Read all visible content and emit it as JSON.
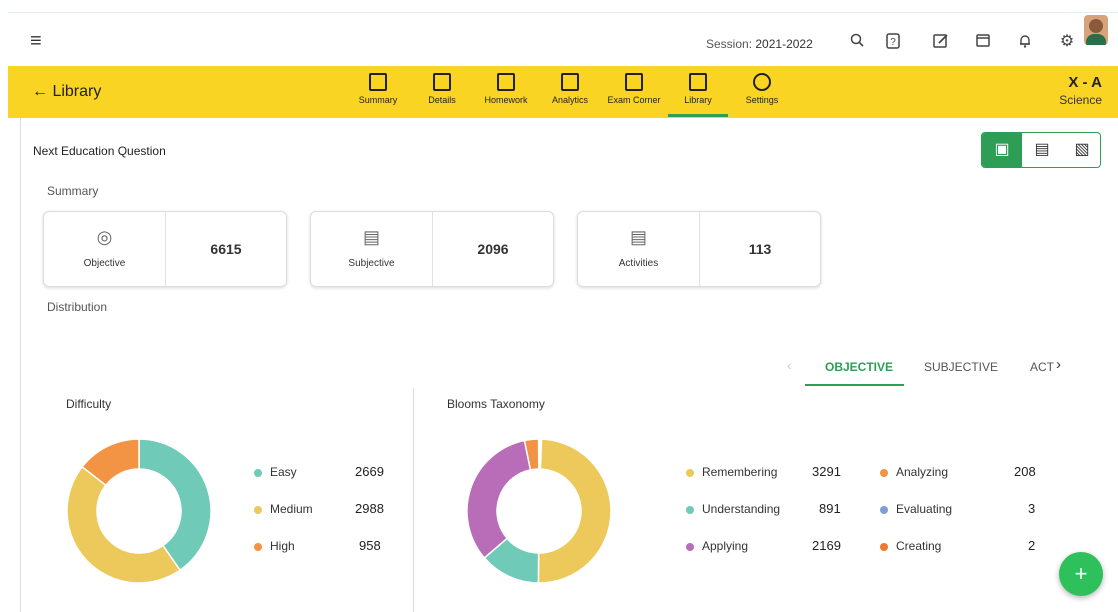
{
  "topbar": {
    "session_label": "Session:",
    "session_value": "2021-2022"
  },
  "header": {
    "back_label": "Library",
    "class_name": "X - A",
    "subject": "Science"
  },
  "nav": {
    "items": [
      {
        "label": "Summary"
      },
      {
        "label": "Details"
      },
      {
        "label": "Homework"
      },
      {
        "label": "Analytics"
      },
      {
        "label": "Exam Corner"
      },
      {
        "label": "Library"
      },
      {
        "label": "Settings"
      }
    ],
    "active": "Library"
  },
  "page": {
    "title": "Next Education Question",
    "summary_label": "Summary",
    "distribution_label": "Distribution"
  },
  "cards": [
    {
      "label": "Objective",
      "value": "6615"
    },
    {
      "label": "Subjective",
      "value": "2096"
    },
    {
      "label": "Activities",
      "value": "113"
    }
  ],
  "tabs": {
    "items": [
      "OBJECTIVE",
      "SUBJECTIVE",
      "ACT"
    ],
    "active": "OBJECTIVE"
  },
  "colors": {
    "accent_green": "#2e9e56",
    "header_yellow": "#f9d423",
    "easy": "#6fcbb8",
    "medium": "#ecc95a",
    "high": "#f39344",
    "remembering": "#ecc95a",
    "understanding": "#6fcbb8",
    "applying": "#b96db8",
    "analyzing": "#f39344",
    "evaluating": "#7b9fd4",
    "creating": "#ef7a2e"
  },
  "chart_data": [
    {
      "type": "pie",
      "title": "Difficulty",
      "categories": [
        "Easy",
        "Medium",
        "High"
      ],
      "values": [
        2669,
        2988,
        958
      ]
    },
    {
      "type": "pie",
      "title": "Blooms Taxonomy",
      "categories": [
        "Remembering",
        "Understanding",
        "Applying",
        "Analyzing",
        "Evaluating",
        "Creating"
      ],
      "values": [
        3291,
        891,
        2169,
        208,
        3,
        2
      ]
    }
  ]
}
